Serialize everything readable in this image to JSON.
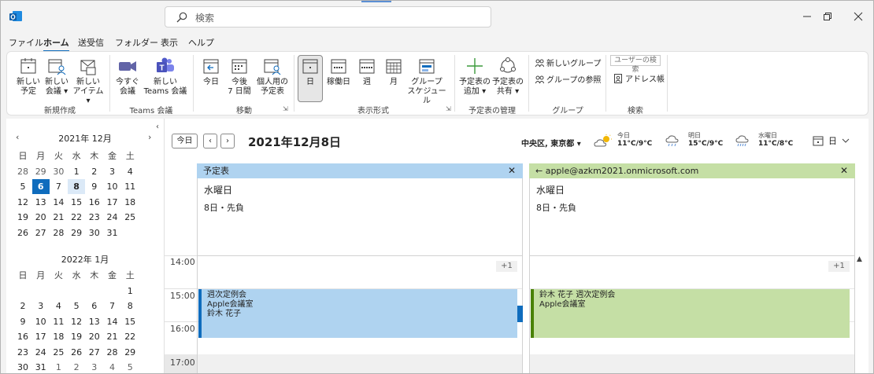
{
  "search": {
    "placeholder": "検索"
  },
  "menu": [
    "ファイル",
    "ホーム",
    "送受信",
    "フォルダー",
    "表示",
    "ヘルプ"
  ],
  "ribbon": {
    "new_appointment": [
      "新しい",
      "予定"
    ],
    "new_meeting": [
      "新しい",
      "会議 ▾"
    ],
    "new_items": [
      "新しい",
      "アイテム ▾"
    ],
    "meet_now": [
      "今すぐ",
      "会議"
    ],
    "new_teams": [
      "新しい",
      "Teams 会議"
    ],
    "today": "今日",
    "next7": [
      "今後",
      "7 日間"
    ],
    "personal": [
      "個人用の",
      "予定表"
    ],
    "day": "日",
    "workweek": "稼働日",
    "week": "週",
    "month": "月",
    "group_schedule": [
      "グループ",
      "スケジュール"
    ],
    "add_calendar": [
      "予定表の",
      "追加 ▾"
    ],
    "share_calendar": [
      "予定表の",
      "共有 ▾"
    ],
    "new_group": "新しいグループ",
    "browse_groups": "グループの参照",
    "search_people": "ユーザーの検索",
    "address_book": "アドレス帳",
    "groups": {
      "new": "新規作成",
      "teams": "Teams 会議",
      "move": "移動",
      "arrange": "表示形式",
      "manage": "予定表の管理",
      "group": "グループ",
      "find": "検索"
    }
  },
  "mini_calendars": [
    {
      "title": "2021年 12月",
      "days_of_week": [
        "日",
        "月",
        "火",
        "水",
        "木",
        "金",
        "土"
      ],
      "weeks": [
        [
          "28",
          "29",
          "30",
          "1",
          "2",
          "3",
          "4"
        ],
        [
          "5",
          "6",
          "7",
          "8",
          "9",
          "10",
          "11"
        ],
        [
          "12",
          "13",
          "14",
          "15",
          "16",
          "17",
          "18"
        ],
        [
          "19",
          "20",
          "21",
          "22",
          "23",
          "24",
          "25"
        ],
        [
          "26",
          "27",
          "28",
          "29",
          "30",
          "31",
          ""
        ]
      ],
      "today": "6",
      "selected": "8"
    },
    {
      "title": "2022年 1月",
      "days_of_week": [
        "日",
        "月",
        "火",
        "水",
        "木",
        "金",
        "土"
      ],
      "weeks": [
        [
          "",
          "",
          "",
          "",
          "",
          "",
          "1"
        ],
        [
          "2",
          "3",
          "4",
          "5",
          "6",
          "7",
          "8"
        ],
        [
          "9",
          "10",
          "11",
          "12",
          "13",
          "14",
          "15"
        ],
        [
          "16",
          "17",
          "18",
          "19",
          "20",
          "21",
          "22"
        ],
        [
          "23",
          "24",
          "25",
          "26",
          "27",
          "28",
          "29"
        ],
        [
          "30",
          "31",
          "1",
          "2",
          "3",
          "4",
          "5"
        ]
      ]
    }
  ],
  "toolbar": {
    "today_button": "今日",
    "date_title": "2021年12月8日",
    "location": "中央区, 東京都 ▾",
    "view_label": "日"
  },
  "weather": [
    {
      "day": "今日",
      "temp": "11°C/9°C",
      "icon": "partly-sunny-icon"
    },
    {
      "day": "明日",
      "temp": "15°C/9°C",
      "icon": "rain-icon"
    },
    {
      "day": "水曜日",
      "temp": "11°C/8°C",
      "icon": "rain-icon"
    }
  ],
  "hours": [
    "14:00",
    "15:00",
    "16:00",
    "17:00"
  ],
  "panes": [
    {
      "title": "予定表",
      "day_name": "水曜日",
      "day_info": "8日・先負",
      "more": "+1",
      "color": "#afd3f0",
      "event_lines": [
        "週次定例会",
        "Apple会議室",
        "鈴木 花子"
      ]
    },
    {
      "title": "←  apple@azkm2021.onmicrosoft.com",
      "day_name": "水曜日",
      "day_info": "8日・先負",
      "more": "+1",
      "color": "#c5dfa5",
      "event_lines": [
        "鈴木 花子 週次定例会",
        "Apple会議室"
      ]
    }
  ]
}
